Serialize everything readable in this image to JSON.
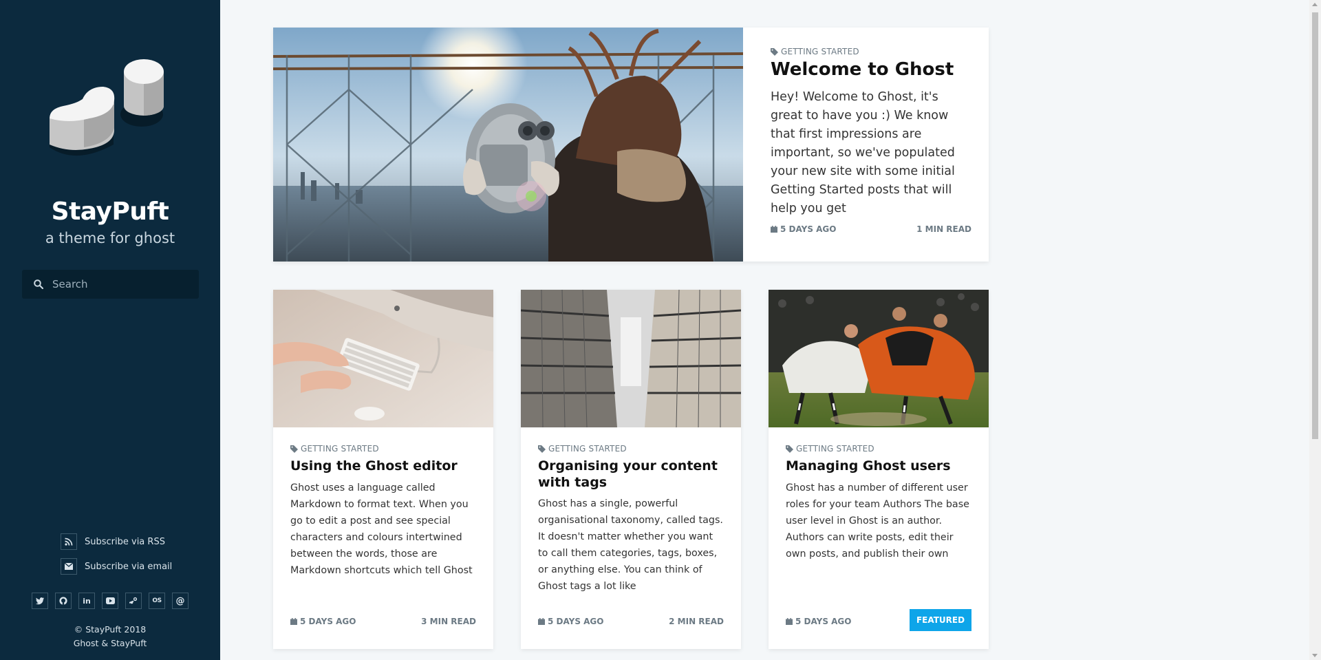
{
  "site": {
    "title": "StayPuft",
    "description": "a theme for ghost",
    "search_placeholder": "Search",
    "subscribe_rss": "Subscribe via RSS",
    "subscribe_email": "Subscribe via email",
    "social_icons": [
      "twitter-icon",
      "github-icon",
      "linkedin-icon",
      "youtube-icon",
      "steam-icon",
      "lastfm-icon",
      "email-icon"
    ],
    "copyright": "© StayPuft 2018",
    "credit": "Ghost & StayPuft"
  },
  "colors": {
    "sidebar_bg": "#0c2a3e",
    "page_bg": "#f4f7f9",
    "accent": "#0ea5e9"
  },
  "featured_post": {
    "tag": "GETTING STARTED",
    "title": "Welcome to Ghost",
    "excerpt": "Hey! Welcome to Ghost, it's great to have you :) We know that first impressions are important, so we've populated your new site with some initial Getting Started posts that will help you get",
    "date": "5 DAYS AGO",
    "read_time": "1 MIN READ"
  },
  "posts": [
    {
      "tag": "GETTING STARTED",
      "title": "Using the Ghost editor",
      "excerpt": "Ghost uses a language called Markdown to format text. When you go to edit a post and see special characters and colours intertwined between the words, those are Markdown shortcuts which tell Ghost",
      "date": "5 DAYS AGO",
      "read_time": "3 MIN READ"
    },
    {
      "tag": "GETTING STARTED",
      "title": "Organising your content with tags",
      "excerpt": "Ghost has a single, powerful organisational taxonomy, called tags. It doesn't matter whether you want to call them categories, tags, boxes, or anything else. You can think of Ghost tags a lot like",
      "date": "5 DAYS AGO",
      "read_time": "2 MIN READ"
    },
    {
      "tag": "GETTING STARTED",
      "title": "Managing Ghost users",
      "excerpt": "Ghost has a number of different user roles for your team Authors The base user level in Ghost is an author. Authors can write posts, edit their own posts, and publish their own",
      "date": "5 DAYS AGO",
      "badge": "FEATURED"
    }
  ]
}
